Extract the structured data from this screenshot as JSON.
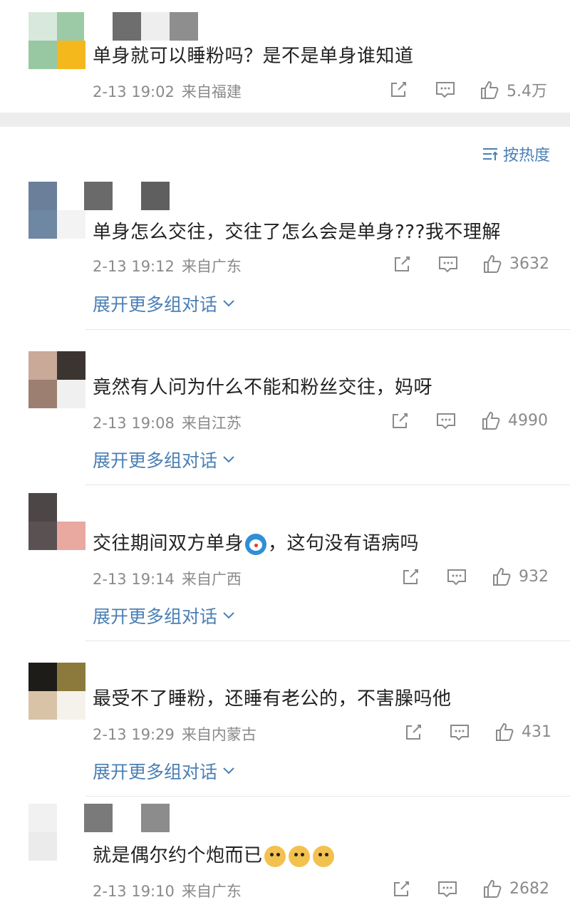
{
  "top_comment": {
    "text": "单身就可以睡粉吗？是不是单身谁知道",
    "time": "2-13 19:02",
    "location": "来自福建",
    "likes": "5.4万"
  },
  "sort_label": "按热度",
  "expand_label": "展开更多组对话",
  "comments": [
    {
      "text": "单身怎么交往，交往了怎么会是单身???我不理解",
      "time": "2-13 19:12",
      "location": "来自广东",
      "likes": "3632"
    },
    {
      "text": "竟然有人问为什么不能和粉丝交往，妈呀",
      "time": "2-13 19:08",
      "location": "来自江苏",
      "likes": "4990"
    },
    {
      "text_before": "交往期间双方单身",
      "text_after": "，这句没有语病吗",
      "emoji": "doraemon-emoji",
      "time": "2-13 19:14",
      "location": "来自广西",
      "likes": "932"
    },
    {
      "text": "最受不了睡粉，还睡有老公的，不害臊吗他",
      "time": "2-13 19:29",
      "location": "来自内蒙古",
      "likes": "431"
    },
    {
      "text": "就是偶尔约个炮而已",
      "emoji": "doge-emoji",
      "emoji_count": 3,
      "time": "2-13 19:10",
      "location": "来自广东",
      "likes": "2682"
    }
  ],
  "colors": {
    "link": "#4a7fb5",
    "meta": "#8a8a8a",
    "text": "#222222",
    "divider": "#e6e6e6",
    "band": "#ededed"
  }
}
